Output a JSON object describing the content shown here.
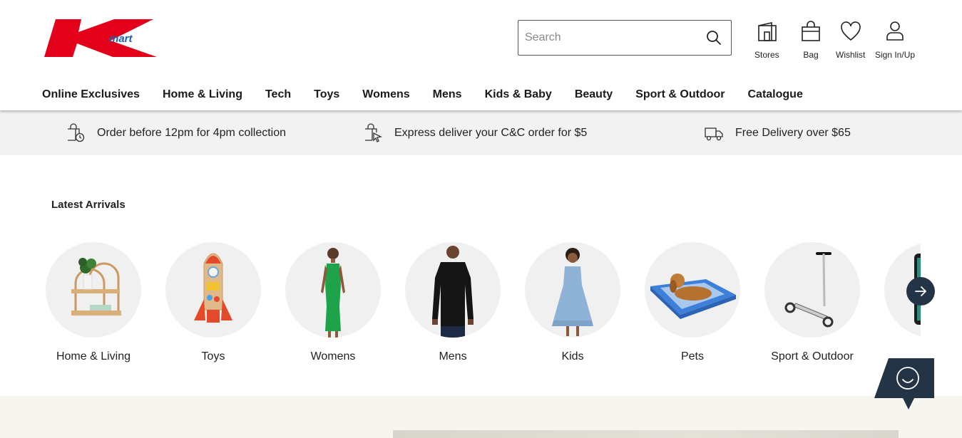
{
  "brand": {
    "name": "Kmart",
    "wordmark": "mart",
    "red": "#e3001b",
    "blue": "#1f5fae"
  },
  "search": {
    "placeholder": "Search"
  },
  "utility": {
    "stores": "Stores",
    "bag": "Bag",
    "wishlist": "Wishlist",
    "sign_in": "Sign In/Up"
  },
  "nav": [
    "Online Exclusives",
    "Home & Living",
    "Tech",
    "Toys",
    "Womens",
    "Mens",
    "Kids & Baby",
    "Beauty",
    "Sport & Outdoor",
    "Catalogue"
  ],
  "promos": [
    {
      "icon": "bag-clock-icon",
      "text": "Order before 12pm for 4pm collection"
    },
    {
      "icon": "bag-cursor-icon",
      "text": "Express deliver your C&C order for $5"
    },
    {
      "icon": "truck-icon",
      "text": "Free Delivery over $65"
    }
  ],
  "latest": {
    "title": "Latest Arrivals",
    "categories": [
      {
        "label": "Home & Living",
        "image": "shelf-image"
      },
      {
        "label": "Toys",
        "image": "rocket-toy-image"
      },
      {
        "label": "Womens",
        "image": "green-dress-image"
      },
      {
        "label": "Mens",
        "image": "black-shirt-image"
      },
      {
        "label": "Kids",
        "image": "blue-dress-girl-image"
      },
      {
        "label": "Pets",
        "image": "dog-bed-image"
      },
      {
        "label": "Sport & Outdoor",
        "image": "scooter-image"
      },
      {
        "label": "",
        "image": "tablet-image"
      }
    ]
  },
  "colors": {
    "navy": "#233447",
    "promo_bg": "#f2f2f2"
  }
}
